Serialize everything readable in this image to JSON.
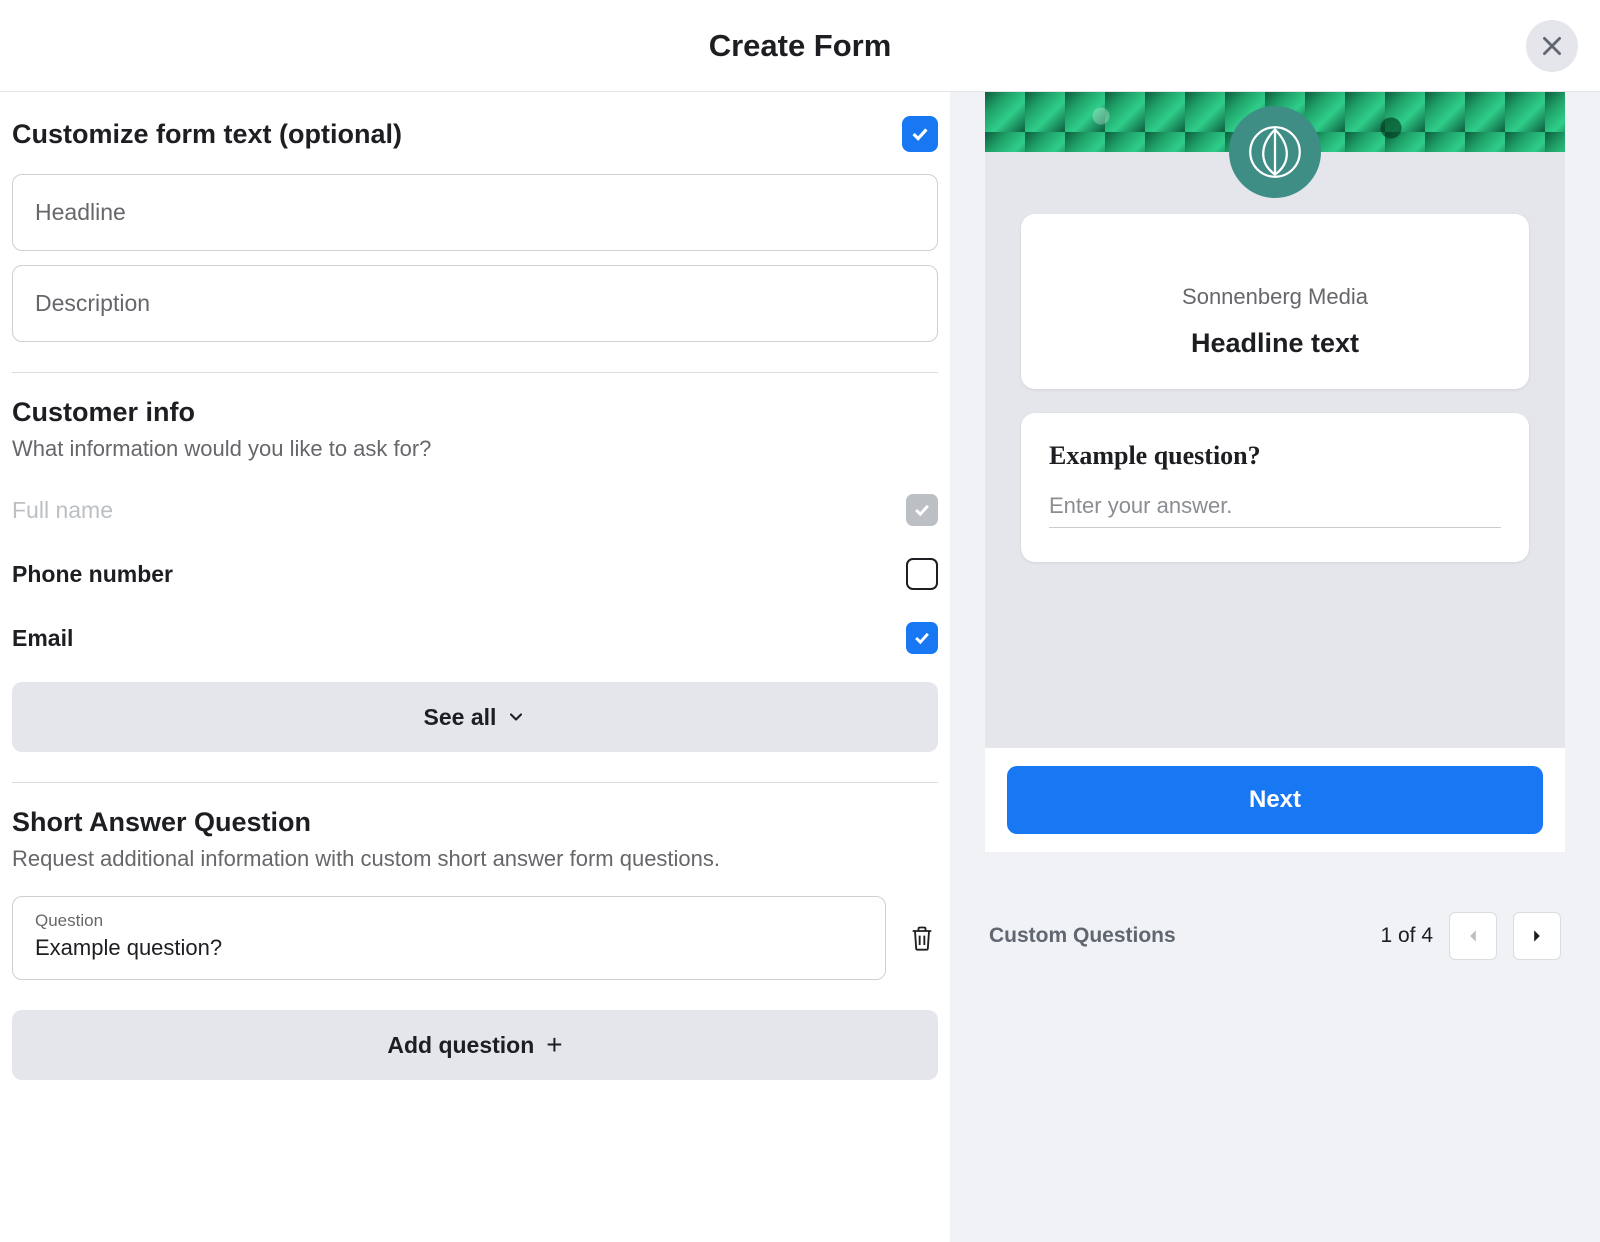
{
  "header": {
    "title": "Create Form"
  },
  "customize": {
    "title": "Customize form text (optional)",
    "headline_placeholder": "Headline",
    "description_placeholder": "Description"
  },
  "customer": {
    "title": "Customer info",
    "subtitle": "What information would you like to ask for?",
    "fields": {
      "full_name": "Full name",
      "phone": "Phone number",
      "email": "Email"
    },
    "see_all": "See all"
  },
  "short_answer": {
    "title": "Short Answer Question",
    "subtitle": "Request additional information with custom short answer form questions.",
    "question_label": "Question",
    "question_value": "Example question?",
    "add_button": "Add question"
  },
  "preview": {
    "brand": "Sonnenberg Media",
    "headline": "Headline text",
    "question": "Example question?",
    "answer_placeholder": "Enter your answer.",
    "next": "Next"
  },
  "pager": {
    "label": "Custom Questions",
    "count": "1 of 4"
  }
}
